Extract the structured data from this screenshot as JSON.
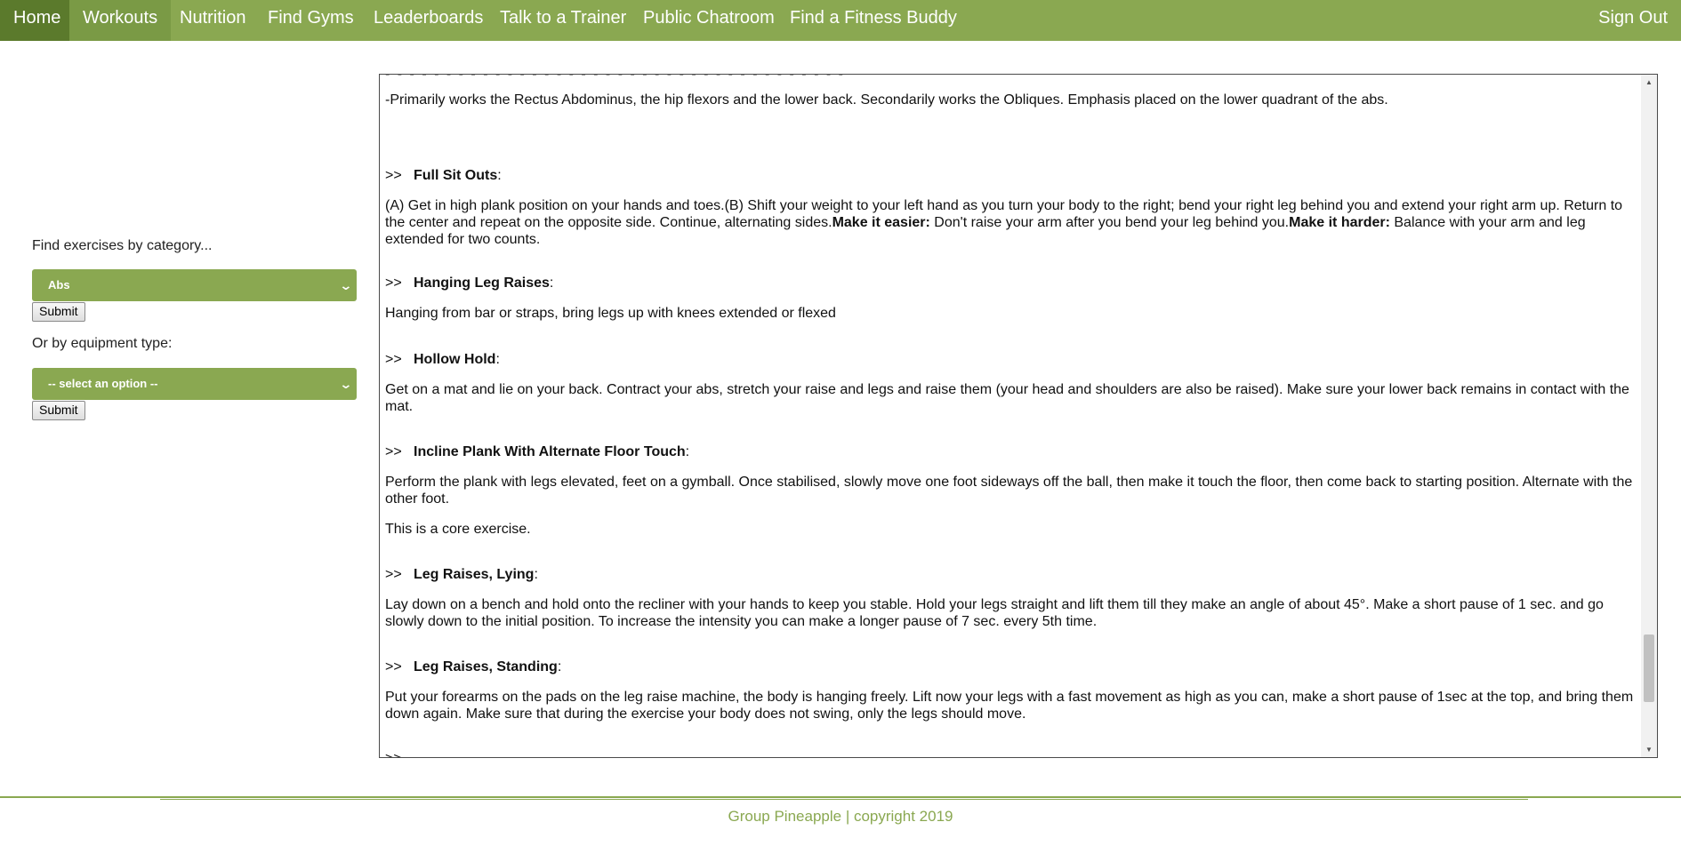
{
  "nav": {
    "items": [
      "Home",
      "Workouts",
      "Nutrition",
      "Find Gyms",
      "Leaderboards",
      "Talk to a Trainer",
      "Public Chatroom",
      "Find a Fitness Buddy"
    ],
    "sign_out": "Sign Out"
  },
  "sidebar": {
    "category_label": "Find exercises by category...",
    "category_value": "Abs",
    "equipment_label": "Or by equipment type:",
    "equipment_value": "-- select an option --",
    "submit_label": "Submit"
  },
  "exercises": {
    "intro": "-Primarily works the Rectus Abdominus, the hip flexors and the lower back. Secondarily works the Obliques.  Emphasis placed on the lower quadrant of the abs.",
    "arrow": ">>",
    "colon": ":",
    "items": [
      {
        "name": "Full Sit Outs",
        "desc_a": "(A) Get in high plank position on your hands and toes.(B) Shift your weight to your left hand as you turn your body to the right; bend your right leg behind you and extend your right arm up. Return to the center and repeat on the opposite side. Continue, alternating sides.",
        "easier_label": "Make it easier:",
        "easier_text": " Don't raise your arm after you bend your leg behind you.",
        "harder_label": "Make it harder:",
        "harder_text": " Balance with your arm and leg extended for two counts."
      },
      {
        "name": "Hanging Leg Raises",
        "desc": "Hanging from bar or straps, bring legs up with knees extended or flexed"
      },
      {
        "name": "Hollow Hold",
        "desc": "Get on a mat and lie on your back. Contract your abs, stretch your raise and legs and raise them (your head and shoulders are also be raised). Make sure your lower back remains in contact with the mat."
      },
      {
        "name": "Incline Plank With Alternate Floor Touch",
        "desc": "Perform the plank with legs elevated, feet on a gymball. Once stabilised, slowly move one foot sideways off the ball, then make it touch the floor, then come back to starting position. Alternate with the other foot.",
        "note": "This is a core exercise."
      },
      {
        "name": "Leg Raises, Lying",
        "desc": "Lay down on a bench and hold onto the recliner with your hands to keep you stable. Hold your legs straight and lift them till they make an angle of about 45°. Make a short pause of 1 sec. and go slowly down to the initial position. To increase the intensity you can make a longer pause of 7 sec. every 5th time."
      },
      {
        "name": "Leg Raises, Standing",
        "desc": "Put your forearms on the pads on the leg raise machine, the body is hanging freely. Lift now your legs with a fast movement as high as you can, make a short pause of 1sec at the top, and bring them down again. Make sure that during the exercise your body does not swing, only the legs should move."
      }
    ]
  },
  "footer": {
    "text": "Group Pineapple | copyright 2019"
  }
}
